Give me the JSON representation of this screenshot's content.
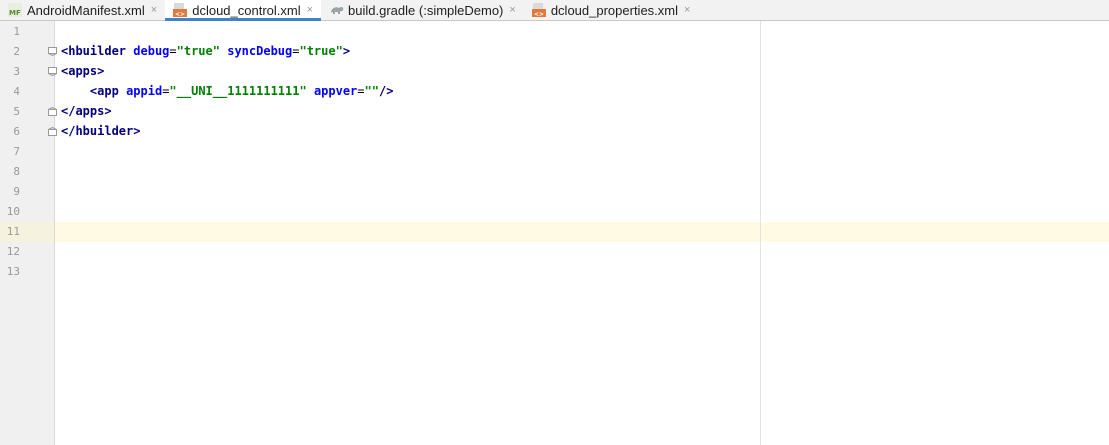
{
  "tabs": [
    {
      "label": "AndroidManifest.xml",
      "icon": "manifest-icon",
      "icon_text": "MF",
      "active": false
    },
    {
      "label": "dcloud_control.xml",
      "icon": "xml-file-icon",
      "icon_text": "<>",
      "active": true
    },
    {
      "label": "build.gradle (:simpleDemo)",
      "icon": "gradle-icon",
      "active": false
    },
    {
      "label": "dcloud_properties.xml",
      "icon": "xml-file-icon",
      "icon_text": "<>",
      "active": false
    }
  ],
  "tab_close_glyph": "×",
  "line_numbers": [
    "1",
    "2",
    "3",
    "4",
    "5",
    "6",
    "7",
    "8",
    "9",
    "10",
    "11",
    "12",
    "13"
  ],
  "code": {
    "line2": {
      "open": "<",
      "tag": "hbuilder",
      "attr1": "debug",
      "eq1": "=",
      "val1": "\"true\"",
      "attr2": "syncDebug",
      "eq2": "=",
      "val2": "\"true\"",
      "close": ">"
    },
    "line3": {
      "open": "<",
      "tag": "apps",
      "close": ">"
    },
    "line4": {
      "indent": "    ",
      "open": "<",
      "tag": "app",
      "attr1": "appid",
      "eq1": "=",
      "val1": "\"__UNI__1111111111\"",
      "attr2": "appver",
      "eq2": "=",
      "val2": "\"\"",
      "close": "/>"
    },
    "line5": {
      "open": "</",
      "tag": "apps",
      "close": ">"
    },
    "line6": {
      "open": "</",
      "tag": "hbuilder",
      "close": ">"
    }
  },
  "colors": {
    "tag": "#000080",
    "attribute": "#0000ff",
    "value": "#008000",
    "active_tab_underline": "#4083c9",
    "current_line": "#fffae3"
  }
}
